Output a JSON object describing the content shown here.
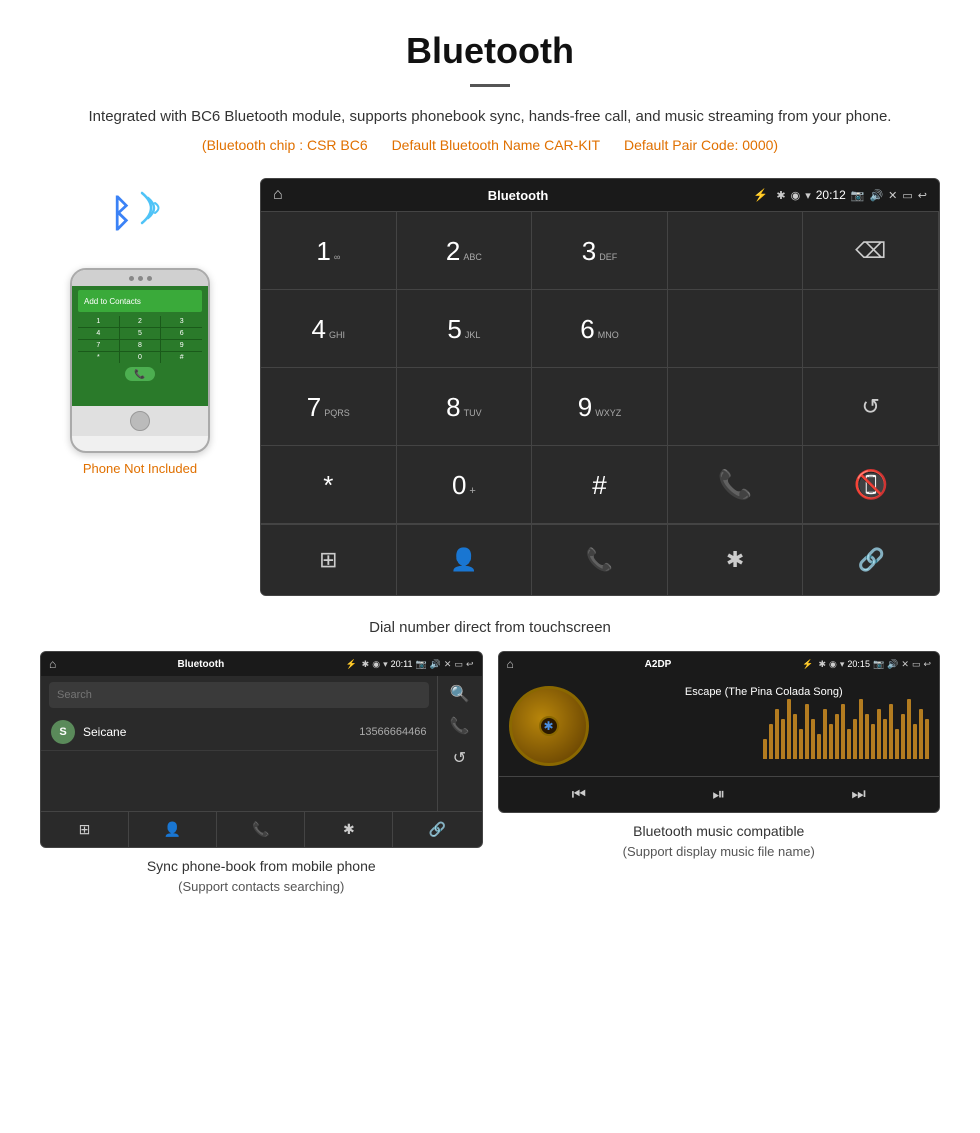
{
  "header": {
    "title": "Bluetooth",
    "description": "Integrated with BC6 Bluetooth module, supports phonebook sync, hands-free call, and music streaming from your phone.",
    "specs": "(Bluetooth chip : CSR BC6    Default Bluetooth Name CAR-KIT    Default Pair Code: 0000)",
    "spec1": "(Bluetooth chip : CSR BC6",
    "spec2": "Default Bluetooth Name CAR-KIT",
    "spec3": "Default Pair Code: 0000)"
  },
  "phone": {
    "not_included_label": "Phone Not Included"
  },
  "dial_screen": {
    "title": "Bluetooth",
    "status_bar": {
      "time": "20:12"
    },
    "keys": [
      {
        "number": "1",
        "sub": "∞",
        "id": "1"
      },
      {
        "number": "2",
        "sub": "ABC",
        "id": "2"
      },
      {
        "number": "3",
        "sub": "DEF",
        "id": "3"
      },
      {
        "number": "",
        "sub": "",
        "id": "empty1"
      },
      {
        "number": "⌫",
        "sub": "",
        "id": "backspace"
      },
      {
        "number": "4",
        "sub": "GHI",
        "id": "4"
      },
      {
        "number": "5",
        "sub": "JKL",
        "id": "5"
      },
      {
        "number": "6",
        "sub": "MNO",
        "id": "6"
      },
      {
        "number": "",
        "sub": "",
        "id": "empty2"
      },
      {
        "number": "",
        "sub": "",
        "id": "empty3"
      },
      {
        "number": "7",
        "sub": "PQRS",
        "id": "7"
      },
      {
        "number": "8",
        "sub": "TUV",
        "id": "8"
      },
      {
        "number": "9",
        "sub": "WXYZ",
        "id": "9"
      },
      {
        "number": "",
        "sub": "",
        "id": "empty4"
      },
      {
        "number": "↺",
        "sub": "",
        "id": "refresh"
      },
      {
        "number": "*",
        "sub": "",
        "id": "star"
      },
      {
        "number": "0",
        "sub": "+",
        "id": "0"
      },
      {
        "number": "#",
        "sub": "",
        "id": "hash"
      },
      {
        "number": "📞",
        "sub": "",
        "id": "call"
      },
      {
        "number": "📵",
        "sub": "",
        "id": "hangup"
      }
    ],
    "bottom_icons": [
      "⊞",
      "👤",
      "📞",
      "✱",
      "🔗"
    ],
    "caption": "Dial number direct from touchscreen"
  },
  "phonebook_screen": {
    "title": "Bluetooth",
    "time": "20:11",
    "search_placeholder": "Search",
    "contacts": [
      {
        "initial": "S",
        "name": "Seicane",
        "number": "13566664466"
      }
    ],
    "caption": "Sync phone-book from mobile phone",
    "caption_sub": "(Support contacts searching)"
  },
  "music_screen": {
    "title": "A2DP",
    "time": "20:15",
    "song_title": "Escape (The Pina Colada Song)",
    "caption": "Bluetooth music compatible",
    "caption_sub": "(Support display music file name)",
    "viz_bars": [
      20,
      35,
      50,
      40,
      60,
      45,
      30,
      55,
      40,
      25,
      50,
      35,
      45,
      55,
      30,
      40,
      60,
      45,
      35,
      50,
      40,
      55,
      30,
      45,
      60,
      35,
      50,
      40
    ]
  },
  "colors": {
    "orange": "#e07000",
    "dark_bg": "#2a2a2a",
    "darker_bg": "#1a1a1a",
    "green_phone": "#4caf50",
    "red_phone": "#f44336",
    "yellow": "#f5a623"
  }
}
